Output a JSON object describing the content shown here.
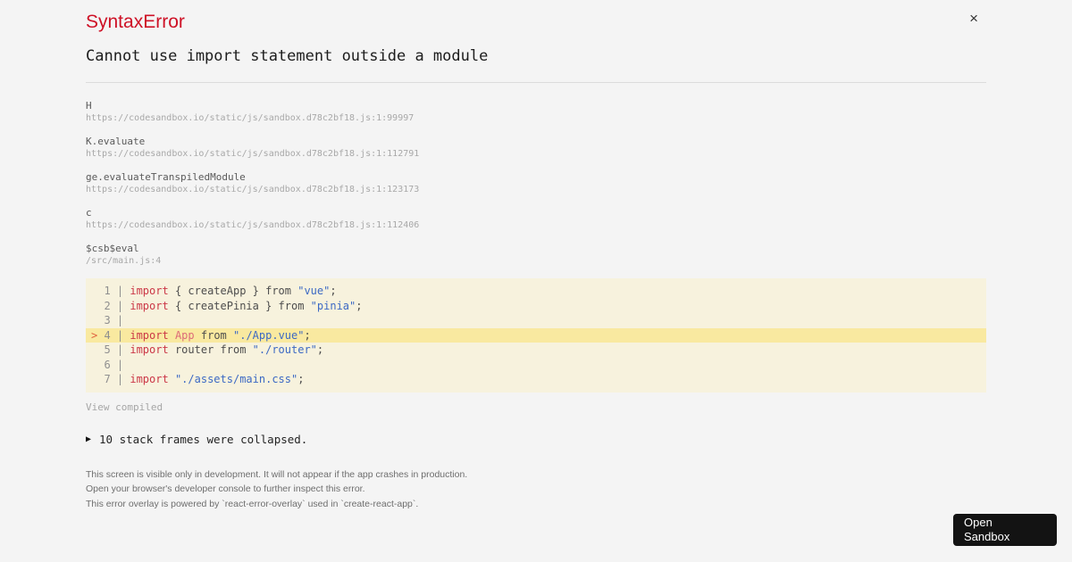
{
  "overlay": {
    "title": "SyntaxError",
    "message": "Cannot use import statement outside a module",
    "close_glyph": "×"
  },
  "stack_frames": [
    {
      "name": "H",
      "location": "https://codesandbox.io/static/js/sandbox.d78c2bf18.js:1:99997"
    },
    {
      "name": "K.evaluate",
      "location": "https://codesandbox.io/static/js/sandbox.d78c2bf18.js:1:112791"
    },
    {
      "name": "ge.evaluateTranspiledModule",
      "location": "https://codesandbox.io/static/js/sandbox.d78c2bf18.js:1:123173"
    },
    {
      "name": "c",
      "location": "https://codesandbox.io/static/js/sandbox.d78c2bf18.js:1:112406"
    },
    {
      "name": "$csb$eval",
      "location": "/src/main.js:4"
    }
  ],
  "code_frame": {
    "lines": [
      {
        "num": "1",
        "marked": false,
        "tokens": [
          {
            "c": "kw",
            "t": "import"
          },
          {
            "c": "plain",
            "t": " { createApp } from "
          },
          {
            "c": "str",
            "t": "\"vue\""
          },
          {
            "c": "plain",
            "t": ";"
          }
        ]
      },
      {
        "num": "2",
        "marked": false,
        "tokens": [
          {
            "c": "kw",
            "t": "import"
          },
          {
            "c": "plain",
            "t": " { createPinia } from "
          },
          {
            "c": "str",
            "t": "\"pinia\""
          },
          {
            "c": "plain",
            "t": ";"
          }
        ]
      },
      {
        "num": "3",
        "marked": false,
        "tokens": []
      },
      {
        "num": "4",
        "marked": true,
        "tokens": [
          {
            "c": "kw",
            "t": "import"
          },
          {
            "c": "plain",
            "t": " "
          },
          {
            "c": "cap",
            "t": "App"
          },
          {
            "c": "plain",
            "t": " from "
          },
          {
            "c": "str",
            "t": "\"./App.vue\""
          },
          {
            "c": "plain",
            "t": ";"
          }
        ]
      },
      {
        "num": "5",
        "marked": false,
        "tokens": [
          {
            "c": "kw",
            "t": "import"
          },
          {
            "c": "plain",
            "t": " router from "
          },
          {
            "c": "str",
            "t": "\"./router\""
          },
          {
            "c": "plain",
            "t": ";"
          }
        ]
      },
      {
        "num": "6",
        "marked": false,
        "tokens": []
      },
      {
        "num": "7",
        "marked": false,
        "tokens": [
          {
            "c": "kw",
            "t": "import"
          },
          {
            "c": "plain",
            "t": " "
          },
          {
            "c": "str",
            "t": "\"./assets/main.css\""
          },
          {
            "c": "plain",
            "t": ";"
          }
        ]
      }
    ]
  },
  "labels": {
    "view_compiled": "View compiled",
    "collapsed_notice": "10 stack frames were collapsed.",
    "open_sandbox": "Open Sandbox"
  },
  "icons": {
    "expand_triangle": "▶"
  },
  "footer_lines": [
    "This screen is visible only in development. It will not appear if the app crashes in production.",
    "Open your browser's developer console to further inspect this error.",
    "This error overlay is powered by `react-error-overlay` used in `create-react-app`."
  ],
  "colors": {
    "error_red": "#ce1126",
    "code_block_bg": "#f7f2dd",
    "marked_line_bg": "#f9e9a0",
    "keyword": "#cb3847",
    "capitalized_identifier": "#dd6b78",
    "string": "#3c69c4",
    "marker": "#e0633f",
    "button_bg": "#131313",
    "page_bg": "#f4f4f4"
  }
}
